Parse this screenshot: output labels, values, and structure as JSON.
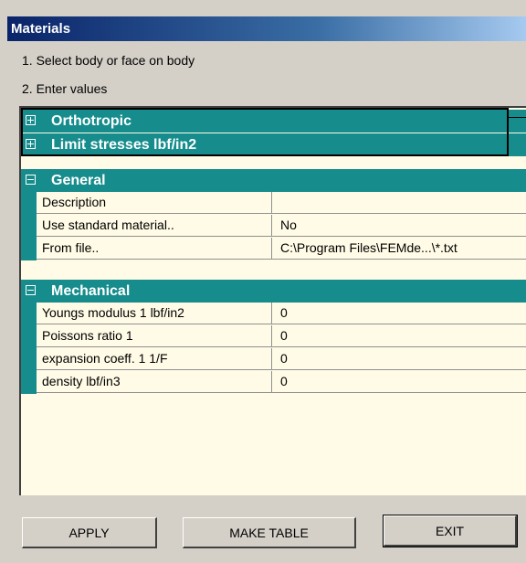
{
  "window": {
    "title": "Materials"
  },
  "instructions": [
    "1. Select body or face on body",
    "2. Enter values"
  ],
  "categories": {
    "orthotropic": "Orthotropic",
    "limit_stresses": "Limit stresses lbf/in2",
    "general": "General",
    "mechanical": "Mechanical"
  },
  "general_rows": [
    {
      "name": "Description",
      "value": ""
    },
    {
      "name": "Use standard material..",
      "value": "No"
    },
    {
      "name": "From file..",
      "value": "C:\\Program Files\\FEMde...\\*.txt"
    }
  ],
  "mechanical_rows": [
    {
      "name": "Youngs modulus 1 lbf/in2",
      "value": "0"
    },
    {
      "name": "Poissons ratio 1",
      "value": "0"
    },
    {
      "name": "expansion coeff. 1 1/F",
      "value": "0"
    },
    {
      "name": "density lbf/in3",
      "value": "0"
    }
  ],
  "buttons": {
    "apply": "APPLY",
    "make_table": "MAKE TABLE",
    "exit": "EXIT"
  },
  "colors": {
    "category_bg": "#168c8c",
    "grid_bg": "#fffbe6",
    "dialog_bg": "#d4d0c8"
  }
}
